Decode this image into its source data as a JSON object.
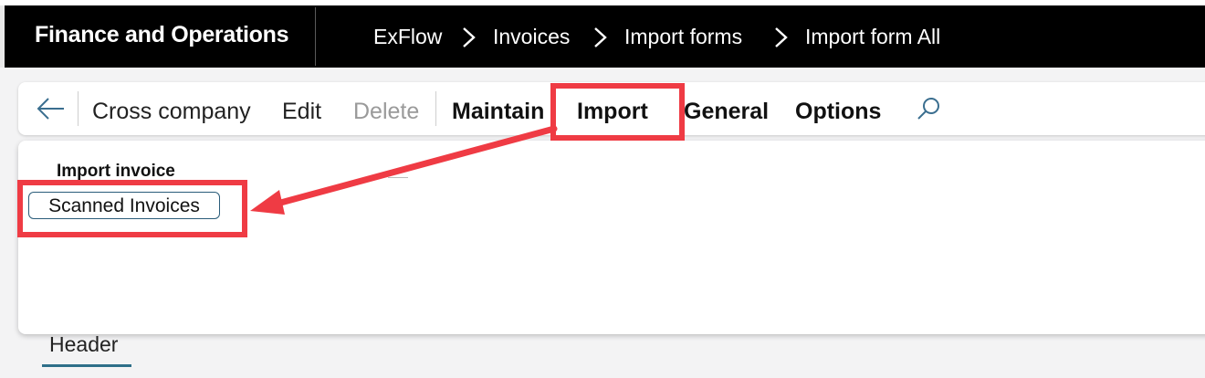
{
  "app": {
    "title": "Finance and Operations"
  },
  "breadcrumb": [
    "ExFlow",
    "Invoices",
    "Import forms",
    "Import form All"
  ],
  "action_pane": {
    "items": [
      "Cross company",
      "Edit",
      "Delete"
    ],
    "tabs": [
      "Maintain",
      "Import",
      "General",
      "Options"
    ],
    "active_tab": "Import"
  },
  "import_panel": {
    "group_label": "Import invoice",
    "button_label": "Scanned Invoices"
  },
  "tabs": {
    "header": "Header"
  },
  "annotation": {
    "color": "#ef3b44"
  },
  "icons": [
    "back-arrow-icon",
    "chevron-right-icon",
    "search-icon"
  ]
}
